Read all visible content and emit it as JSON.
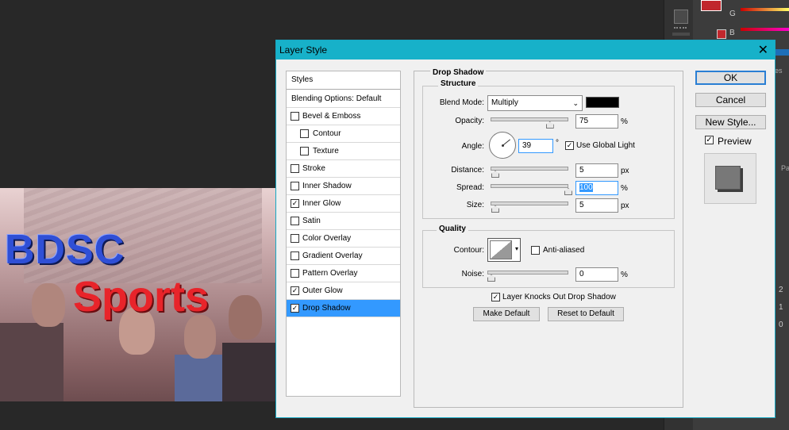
{
  "dialog": {
    "title": "Layer Style",
    "close": "✕",
    "styles_header": "Styles",
    "blending": "Blending Options: Default",
    "effects": [
      {
        "label": "Bevel & Emboss",
        "checked": false,
        "indent": false
      },
      {
        "label": "Contour",
        "checked": false,
        "indent": true
      },
      {
        "label": "Texture",
        "checked": false,
        "indent": true
      },
      {
        "label": "Stroke",
        "checked": false,
        "indent": false
      },
      {
        "label": "Inner Shadow",
        "checked": false,
        "indent": false
      },
      {
        "label": "Inner Glow",
        "checked": true,
        "indent": false
      },
      {
        "label": "Satin",
        "checked": false,
        "indent": false
      },
      {
        "label": "Color Overlay",
        "checked": false,
        "indent": false
      },
      {
        "label": "Gradient Overlay",
        "checked": false,
        "indent": false
      },
      {
        "label": "Pattern Overlay",
        "checked": false,
        "indent": false
      },
      {
        "label": "Outer Glow",
        "checked": true,
        "indent": false
      },
      {
        "label": "Drop Shadow",
        "checked": true,
        "indent": false,
        "selected": true
      }
    ],
    "panel": {
      "section_title": "Drop Shadow",
      "structure_title": "Structure",
      "blend_mode_label": "Blend Mode:",
      "blend_mode_value": "Multiply",
      "blend_color": "#000000",
      "opacity_label": "Opacity:",
      "opacity_value": "75",
      "opacity_unit": "%",
      "opacity_level": 0.75,
      "angle_label": "Angle:",
      "angle_value": "39",
      "angle_unit": "°",
      "use_global_light": "Use Global Light",
      "use_global_light_checked": true,
      "distance_label": "Distance:",
      "distance_value": "5",
      "distance_unit": "px",
      "spread_label": "Spread:",
      "spread_value": "100",
      "spread_unit": "%",
      "size_label": "Size:",
      "size_value": "5",
      "size_unit": "px",
      "quality_title": "Quality",
      "contour_label": "Contour:",
      "anti_aliased": "Anti-aliased",
      "noise_label": "Noise:",
      "noise_value": "0",
      "noise_unit": "%",
      "knocks_out": "Layer Knocks Out Drop Shadow",
      "make_default": "Make Default",
      "reset_default": "Reset to Default"
    },
    "ok": "OK",
    "cancel": "Cancel",
    "new_style": "New Style...",
    "preview": "Preview"
  },
  "canvas": {
    "text1": "BDSC",
    "text2": "Sports"
  },
  "right_panel": {
    "g_label": "G",
    "b_label": "B",
    "num1": "2",
    "num2": "1",
    "num3": "0",
    "tab1": "es",
    "tab2": "Pa"
  }
}
